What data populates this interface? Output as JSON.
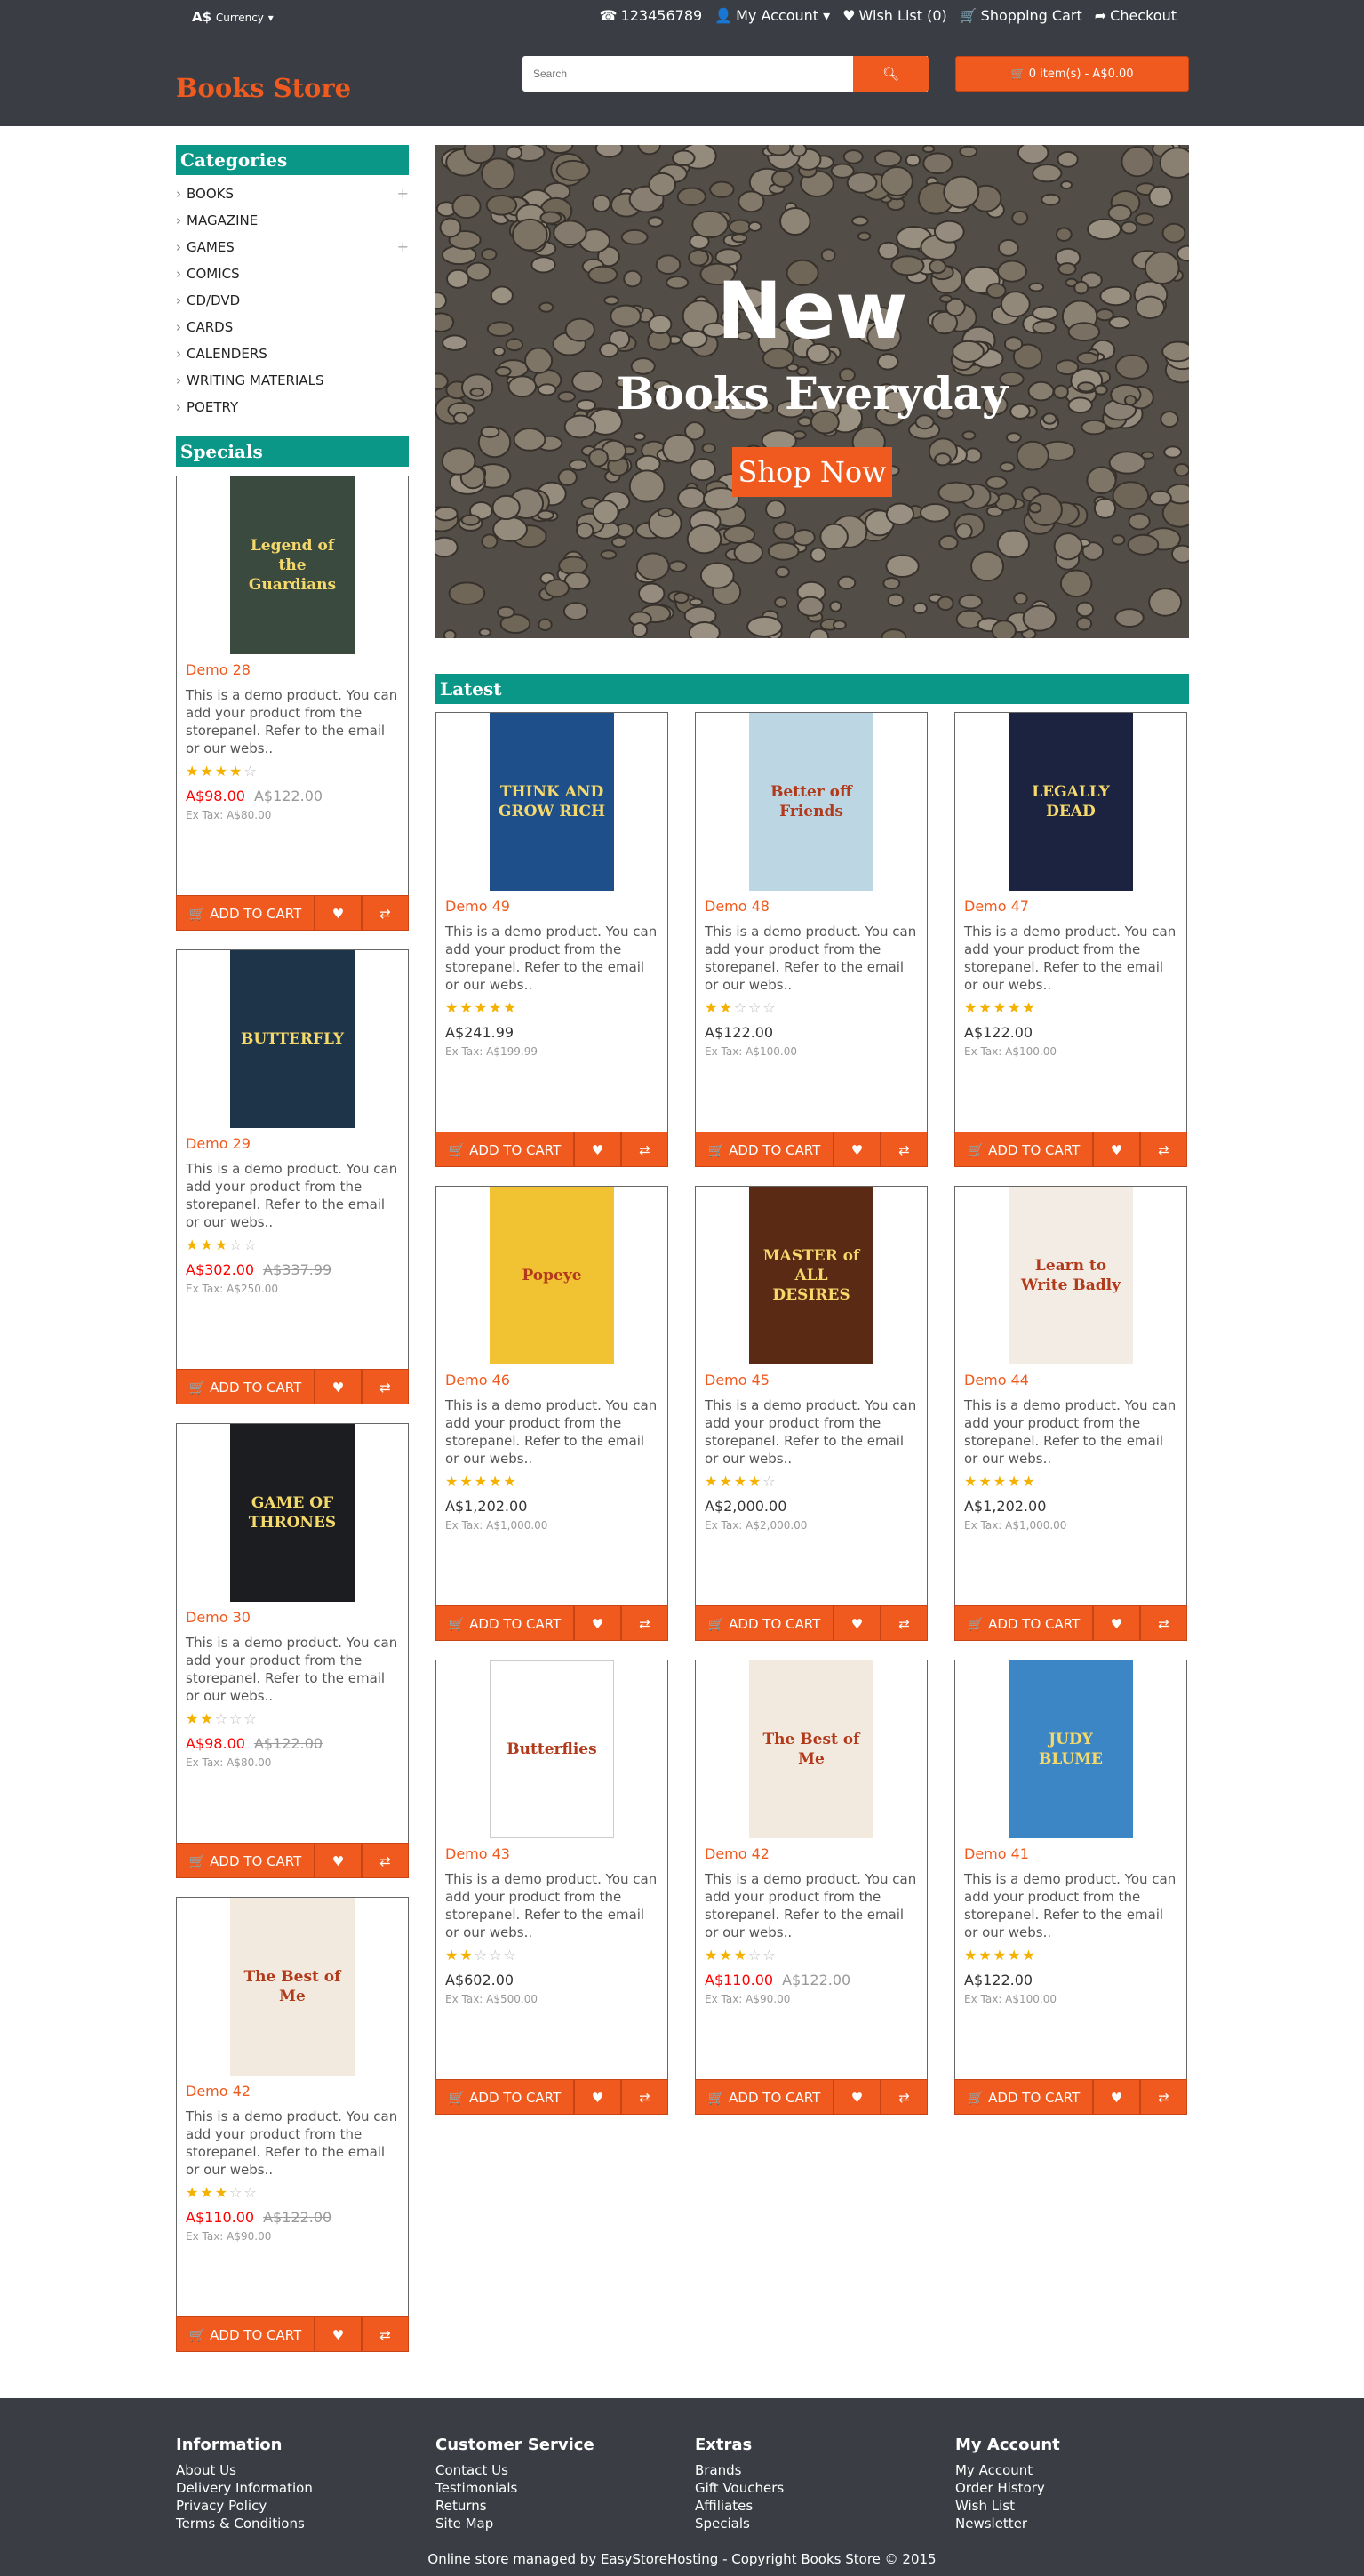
{
  "topbar": {
    "currency": "A$",
    "currency_label": "Currency",
    "phone": "123456789",
    "my_account": "My Account",
    "wishlist": "Wish List (0)",
    "cart": "Shopping Cart",
    "checkout": "Checkout"
  },
  "header": {
    "logo": "Books Store",
    "search_placeholder": "Search",
    "cart_button": "0 item(s) - A$0.00"
  },
  "sidebar": {
    "categories_title": "Categories",
    "categories": [
      {
        "label": "BOOKS",
        "expandable": true
      },
      {
        "label": "MAGAZINE",
        "expandable": false
      },
      {
        "label": "GAMES",
        "expandable": true
      },
      {
        "label": "COMICS",
        "expandable": false
      },
      {
        "label": "CD/DVD",
        "expandable": false
      },
      {
        "label": "CARDS",
        "expandable": false
      },
      {
        "label": "CALENDERS",
        "expandable": false
      },
      {
        "label": "WRITING MATERIALS",
        "expandable": false
      },
      {
        "label": "POETRY",
        "expandable": false
      }
    ],
    "specials_title": "Specials"
  },
  "banner": {
    "line1": "New",
    "line2": "Books Everyday",
    "button": "Shop Now"
  },
  "latest_title": "Latest",
  "buttons": {
    "add_to_cart": "ADD TO CART"
  },
  "description": "This is a demo product. You can add your product from the storepanel. Refer to the email or our webs..",
  "specials": [
    {
      "name": "Demo 28",
      "rating": 4,
      "price": "A$98.00",
      "old_price": "A$122.00",
      "ex_tax": "Ex Tax: A$80.00",
      "cover": "Legend of the Guardians",
      "cover_color": "#3b4a3f"
    },
    {
      "name": "Demo 29",
      "rating": 3,
      "price": "A$302.00",
      "old_price": "A$337.99",
      "ex_tax": "Ex Tax: A$250.00",
      "cover": "BUTTERFLY",
      "cover_color": "#1e3448"
    },
    {
      "name": "Demo 30",
      "rating": 2,
      "price": "A$98.00",
      "old_price": "A$122.00",
      "ex_tax": "Ex Tax: A$80.00",
      "cover": "GAME OF THRONES",
      "cover_color": "#1b1d20"
    },
    {
      "name": "Demo 42",
      "rating": 3,
      "price": "A$110.00",
      "old_price": "A$122.00",
      "ex_tax": "Ex Tax: A$90.00",
      "cover": "The Best of Me",
      "cover_color": "#f2e9df"
    }
  ],
  "latest": [
    {
      "name": "Demo 49",
      "rating": 5,
      "price": "A$241.99",
      "old_price": "",
      "ex_tax": "Ex Tax: A$199.99",
      "cover": "THINK AND GROW RICH",
      "cover_color": "#1e4f8a"
    },
    {
      "name": "Demo 48",
      "rating": 2,
      "price": "A$122.00",
      "old_price": "",
      "ex_tax": "Ex Tax: A$100.00",
      "cover": "Better off Friends",
      "cover_color": "#bcd7e3"
    },
    {
      "name": "Demo 47",
      "rating": 5,
      "price": "A$122.00",
      "old_price": "",
      "ex_tax": "Ex Tax: A$100.00",
      "cover": "LEGALLY DEAD",
      "cover_color": "#1c2340"
    },
    {
      "name": "Demo 46",
      "rating": 5,
      "price": "A$1,202.00",
      "old_price": "",
      "ex_tax": "Ex Tax: A$1,000.00",
      "cover": "Popeye",
      "cover_color": "#f1c232"
    },
    {
      "name": "Demo 45",
      "rating": 4,
      "price": "A$2,000.00",
      "old_price": "",
      "ex_tax": "Ex Tax: A$2,000.00",
      "cover": "MASTER of ALL DESIRES",
      "cover_color": "#5a2a14"
    },
    {
      "name": "Demo 44",
      "rating": 5,
      "price": "A$1,202.00",
      "old_price": "",
      "ex_tax": "Ex Tax: A$1,000.00",
      "cover": "Learn to Write Badly",
      "cover_color": "#f3ece4"
    },
    {
      "name": "Demo 43",
      "rating": 2,
      "price": "A$602.00",
      "old_price": "",
      "ex_tax": "Ex Tax: A$500.00",
      "cover": "Butterflies",
      "cover_color": "#ffffff"
    },
    {
      "name": "Demo 42",
      "rating": 3,
      "price": "A$110.00",
      "old_price": "A$122.00",
      "ex_tax": "Ex Tax: A$90.00",
      "cover": "The Best of Me",
      "cover_color": "#f2e9df"
    },
    {
      "name": "Demo 41",
      "rating": 5,
      "price": "A$122.00",
      "old_price": "",
      "ex_tax": "Ex Tax: A$100.00",
      "cover": "JUDY BLUME",
      "cover_color": "#3d86c6"
    }
  ],
  "footer": {
    "columns": [
      {
        "title": "Information",
        "links": [
          "About Us",
          "Delivery Information",
          "Privacy Policy",
          "Terms & Conditions"
        ]
      },
      {
        "title": "Customer Service",
        "links": [
          "Contact Us",
          "Testimonials",
          "Returns",
          "Site Map"
        ]
      },
      {
        "title": "Extras",
        "links": [
          "Brands",
          "Gift Vouchers",
          "Affiliates",
          "Specials"
        ]
      },
      {
        "title": "My Account",
        "links": [
          "My Account",
          "Order History",
          "Wish List",
          "Newsletter"
        ]
      }
    ],
    "copyright": "Online store managed by EasyStoreHosting - Copyright Books Store © 2015"
  },
  "colors": {
    "accent": "#f05a1e",
    "teal": "#0b9787",
    "header_bg": "#3a3e44"
  }
}
